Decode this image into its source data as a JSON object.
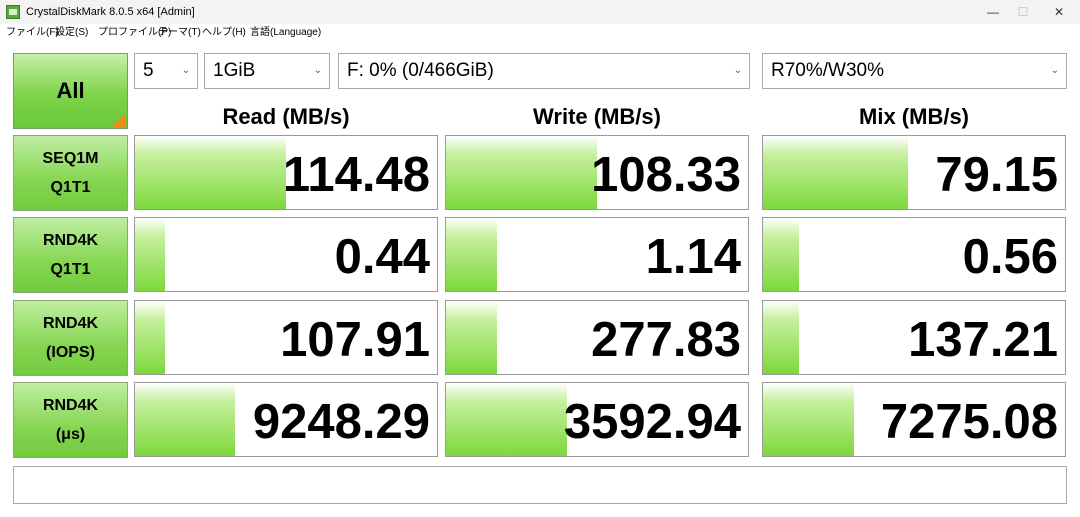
{
  "window": {
    "title": "CrystalDiskMark 8.0.5 x64 [Admin]",
    "min_glyph": "—",
    "max_glyph": "☐",
    "close_glyph": "✕"
  },
  "menu": [
    {
      "label": "ファイル(F)"
    },
    {
      "label": "設定(S)"
    },
    {
      "label": "プロファイル(P)"
    },
    {
      "label": "テーマ(T)"
    },
    {
      "label": "ヘルプ(H)"
    },
    {
      "label": "言語(Language)"
    }
  ],
  "controls": {
    "all_label": "All",
    "count": "5",
    "size": "1GiB",
    "drive": "F: 0% (0/466GiB)",
    "mix": "R70%/W30%"
  },
  "headers": {
    "read": "Read (MB/s)",
    "write": "Write (MB/s)",
    "mix": "Mix (MB/s)"
  },
  "rows": [
    {
      "label1": "SEQ1M",
      "label2": "Q1T1",
      "read": "114.48",
      "write": "108.33",
      "mix": "79.15",
      "read_fill": 0.5,
      "write_fill": 0.5,
      "mix_fill": 0.48
    },
    {
      "label1": "RND4K",
      "label2": "Q1T1",
      "read": "0.44",
      "write": "1.14",
      "mix": "0.56",
      "read_fill": 0.1,
      "write_fill": 0.17,
      "mix_fill": 0.12
    },
    {
      "label1": "RND4K",
      "label2": "(IOPS)",
      "read": "107.91",
      "write": "277.83",
      "mix": "137.21",
      "read_fill": 0.1,
      "write_fill": 0.17,
      "mix_fill": 0.12
    },
    {
      "label1": "RND4K",
      "label2": "(μs)",
      "read": "9248.29",
      "write": "3592.94",
      "mix": "7275.08",
      "read_fill": 0.33,
      "write_fill": 0.4,
      "mix_fill": 0.3
    }
  ],
  "status": "",
  "colors": {
    "accent_green": "#7dd83c",
    "corner_orange": "#f08c1e"
  }
}
